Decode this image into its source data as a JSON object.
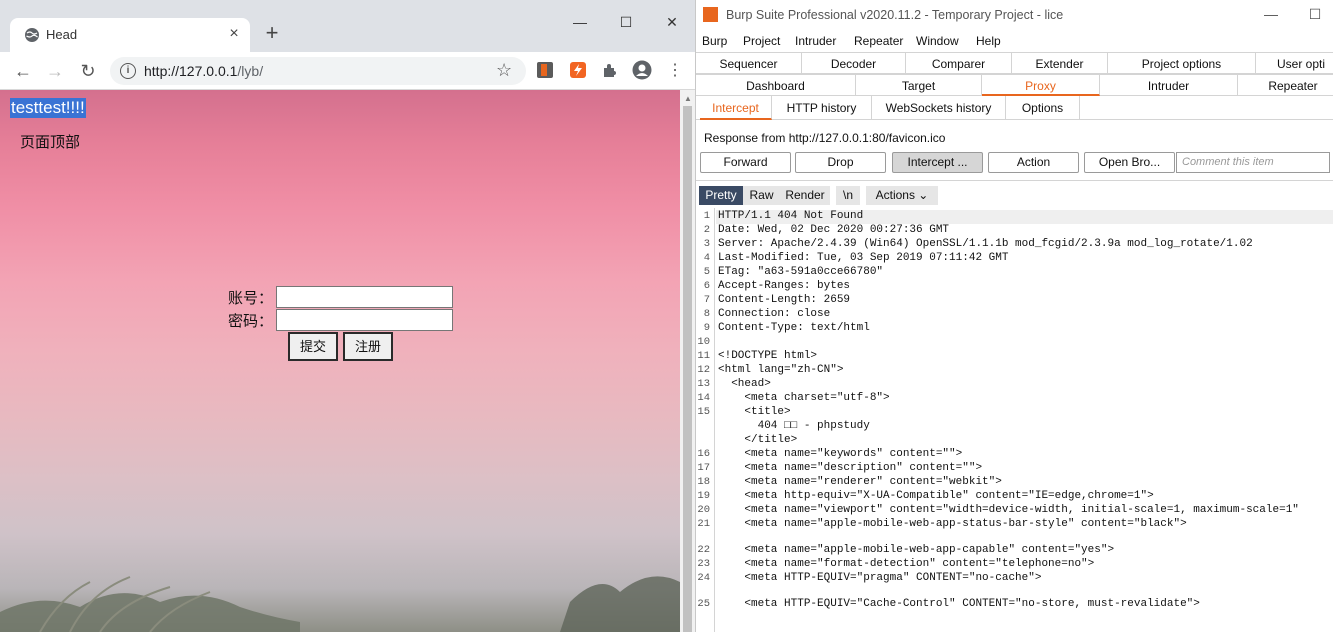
{
  "browser": {
    "tab_title": "Head",
    "tab_close": "×",
    "new_tab": "+",
    "url_host": "http://127.0.0.1",
    "url_path": "/lyb/",
    "win_minimize": "—",
    "win_maximize": "☐",
    "win_close": "✕",
    "page": {
      "heading": "testtest!!!!",
      "top_text": "页面顶部",
      "account_label": "账号：",
      "password_label": "密码：",
      "submit_label": "提交",
      "register_label": "注册"
    }
  },
  "burp": {
    "title": "Burp Suite Professional v2020.11.2 - Temporary Project - lice",
    "win_minimize": "—",
    "win_maximize": "☐",
    "menu": [
      "Burp",
      "Project",
      "Intruder",
      "Repeater",
      "Window",
      "Help"
    ],
    "tabs_row1": [
      "Sequencer",
      "Decoder",
      "Comparer",
      "Extender",
      "Project options",
      "User opti"
    ],
    "tabs_row2": [
      "Dashboard",
      "Target",
      "Proxy",
      "Intruder",
      "Repeater"
    ],
    "active_tab": "Proxy",
    "proxy_tabs": [
      "Intercept",
      "HTTP history",
      "WebSockets history",
      "Options"
    ],
    "active_proxy_tab": "Intercept",
    "response_from": "Response from http://127.0.0.1:80/favicon.ico",
    "buttons": {
      "forward": "Forward",
      "drop": "Drop",
      "intercept": "Intercept ...",
      "action": "Action",
      "open_browser": "Open Bro..."
    },
    "comment_placeholder": "Comment this item",
    "view_tabs": {
      "pretty": "Pretty",
      "raw": "Raw",
      "render": "Render",
      "newline": "\\n",
      "actions": "Actions ⌄"
    },
    "response_lines": [
      {
        "n": "1",
        "text": "HTTP/1.1 404 Not Found"
      },
      {
        "n": "2",
        "text": "Date: Wed, 02 Dec 2020 00:27:36 GMT"
      },
      {
        "n": "3",
        "text": "Server: Apache/2.4.39 (Win64) OpenSSL/1.1.1b mod_fcgid/2.3.9a mod_log_rotate/1.02"
      },
      {
        "n": "4",
        "text": "Last-Modified: Tue, 03 Sep 2019 07:11:42 GMT"
      },
      {
        "n": "5",
        "text": "ETag: \"a63-591a0cce66780\""
      },
      {
        "n": "6",
        "text": "Accept-Ranges: bytes"
      },
      {
        "n": "7",
        "text": "Content-Length: 2659"
      },
      {
        "n": "8",
        "text": "Connection: close"
      },
      {
        "n": "9",
        "text": "Content-Type: text/html"
      },
      {
        "n": "10",
        "text": ""
      },
      {
        "n": "11",
        "text": "<!DOCTYPE html>"
      },
      {
        "n": "12",
        "text": "<html lang=\"zh-CN\">"
      },
      {
        "n": "13",
        "text": "  <head>"
      },
      {
        "n": "14",
        "text": "    <meta charset=\"utf-8\">"
      },
      {
        "n": "15",
        "text": "    <title>"
      },
      {
        "n": "",
        "text": "      404 □□ - phpstudy"
      },
      {
        "n": "",
        "text": "    </title>"
      },
      {
        "n": "16",
        "text": "    <meta name=\"keywords\" content=\"\">"
      },
      {
        "n": "17",
        "text": "    <meta name=\"description\" content=\"\">"
      },
      {
        "n": "18",
        "text": "    <meta name=\"renderer\" content=\"webkit\">"
      },
      {
        "n": "19",
        "text": "    <meta http-equiv=\"X-UA-Compatible\" content=\"IE=edge,chrome=1\">"
      },
      {
        "n": "20",
        "text": "    <meta name=\"viewport\" content=\"width=device-width, initial-scale=1, maximum-scale=1\""
      },
      {
        "n": "21",
        "text": "    <meta name=\"apple-mobile-web-app-status-bar-style\" content=\"black\">"
      },
      {
        "n": "",
        "text": ""
      },
      {
        "n": "22",
        "text": "    <meta name=\"apple-mobile-web-app-capable\" content=\"yes\">"
      },
      {
        "n": "23",
        "text": "    <meta name=\"format-detection\" content=\"telephone=no\">"
      },
      {
        "n": "24",
        "text": "    <meta HTTP-EQUIV=\"pragma\" CONTENT=\"no-cache\">"
      },
      {
        "n": "",
        "text": ""
      },
      {
        "n": "25",
        "text": "    <meta HTTP-EQUIV=\"Cache-Control\" CONTENT=\"no-store, must-revalidate\">"
      }
    ]
  }
}
